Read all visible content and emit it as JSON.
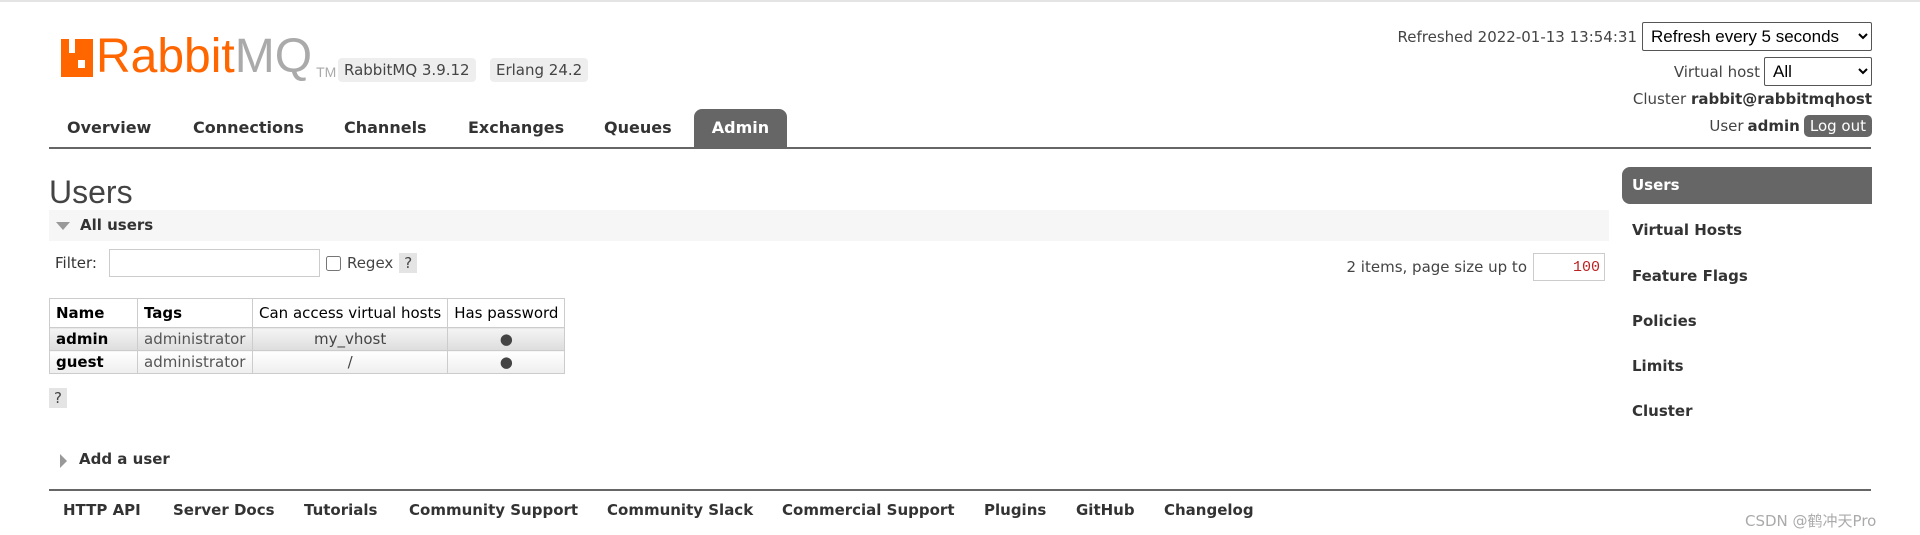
{
  "header": {
    "logo_text_orange": "Rabbit",
    "logo_text_gray": "MQ",
    "logo_tm": "TM",
    "version_badge": "RabbitMQ 3.9.12",
    "erlang_badge": "Erlang 24.2"
  },
  "top_right": {
    "refreshed_label": "Refreshed 2022-01-13 13:54:31",
    "refresh_select": "Refresh every 5 seconds",
    "vhost_label": "Virtual host",
    "vhost_select": "All",
    "cluster_label": "Cluster",
    "cluster_name": "rabbit@rabbitmqhost",
    "user_label": "User",
    "user_name": "admin",
    "logout": "Log out"
  },
  "tabs": [
    {
      "label": "Overview"
    },
    {
      "label": "Connections"
    },
    {
      "label": "Channels"
    },
    {
      "label": "Exchanges"
    },
    {
      "label": "Queues"
    },
    {
      "label": "Admin",
      "active": true
    }
  ],
  "main": {
    "title": "Users",
    "section": "All users",
    "filter_label": "Filter:",
    "filter_value": "",
    "regex_label": "Regex",
    "help": "?",
    "paging_text": "2 items, page size up to",
    "page_size": "100",
    "add_user": "Add a user",
    "table": {
      "headers": [
        "Name",
        "Tags",
        "Can access virtual hosts",
        "Has password"
      ],
      "rows": [
        [
          "admin",
          "administrator",
          "my_vhost",
          "●"
        ],
        [
          "guest",
          "administrator",
          "/",
          "●"
        ]
      ]
    }
  },
  "sidebar": {
    "items": [
      {
        "label": "Users",
        "active": true
      },
      {
        "label": "Virtual Hosts"
      },
      {
        "label": "Feature Flags"
      },
      {
        "label": "Policies"
      },
      {
        "label": "Limits"
      },
      {
        "label": "Cluster"
      }
    ]
  },
  "footer": {
    "links": [
      "HTTP API",
      "Server Docs",
      "Tutorials",
      "Community Support",
      "Community Slack",
      "Commercial Support",
      "Plugins",
      "GitHub",
      "Changelog"
    ]
  },
  "watermark": "CSDN @鹤冲天Pro",
  "colors": {
    "brand": "#ff6600",
    "tab_active": "#666666"
  }
}
